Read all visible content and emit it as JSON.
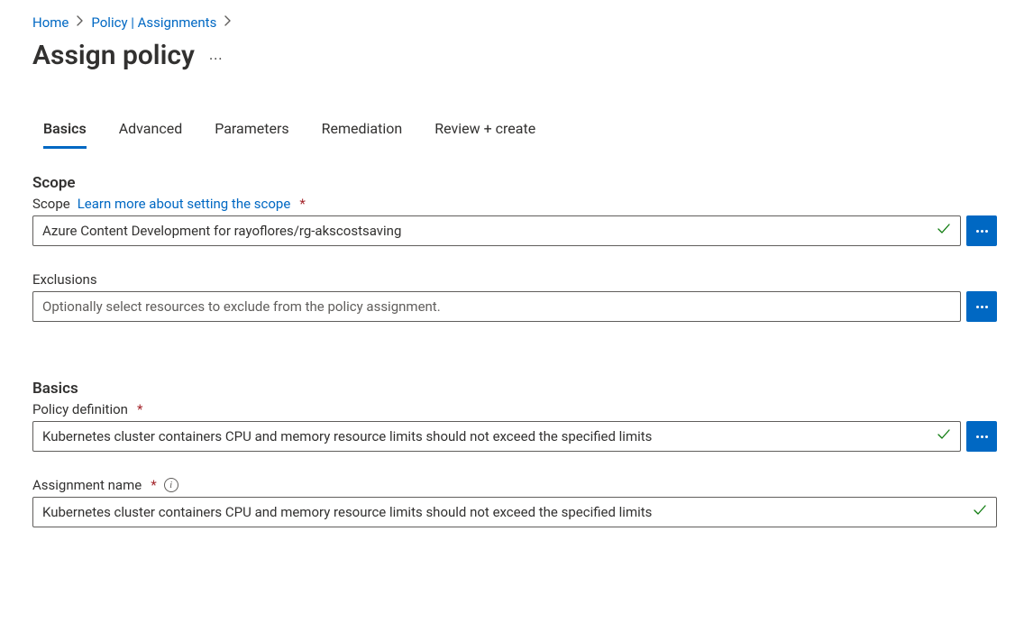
{
  "breadcrumb": {
    "home": "Home",
    "policy": "Policy | Assignments"
  },
  "header": {
    "title": "Assign policy"
  },
  "tabs": {
    "basics": "Basics",
    "advanced": "Advanced",
    "parameters": "Parameters",
    "remediation": "Remediation",
    "review": "Review + create"
  },
  "scope_section": {
    "heading": "Scope",
    "label": "Scope",
    "learn_more": "Learn more about setting the scope",
    "value": "Azure Content Development for rayoflores/rg-akscostsaving"
  },
  "exclusions": {
    "label": "Exclusions",
    "placeholder": "Optionally select resources to exclude from the policy assignment."
  },
  "basics_section": {
    "heading": "Basics",
    "policy_def_label": "Policy definition",
    "policy_def_value": "Kubernetes cluster containers CPU and memory resource limits should not exceed the specified limits",
    "assignment_label": "Assignment name",
    "assignment_value": "Kubernetes cluster containers CPU and memory resource limits should not exceed the specified limits"
  }
}
